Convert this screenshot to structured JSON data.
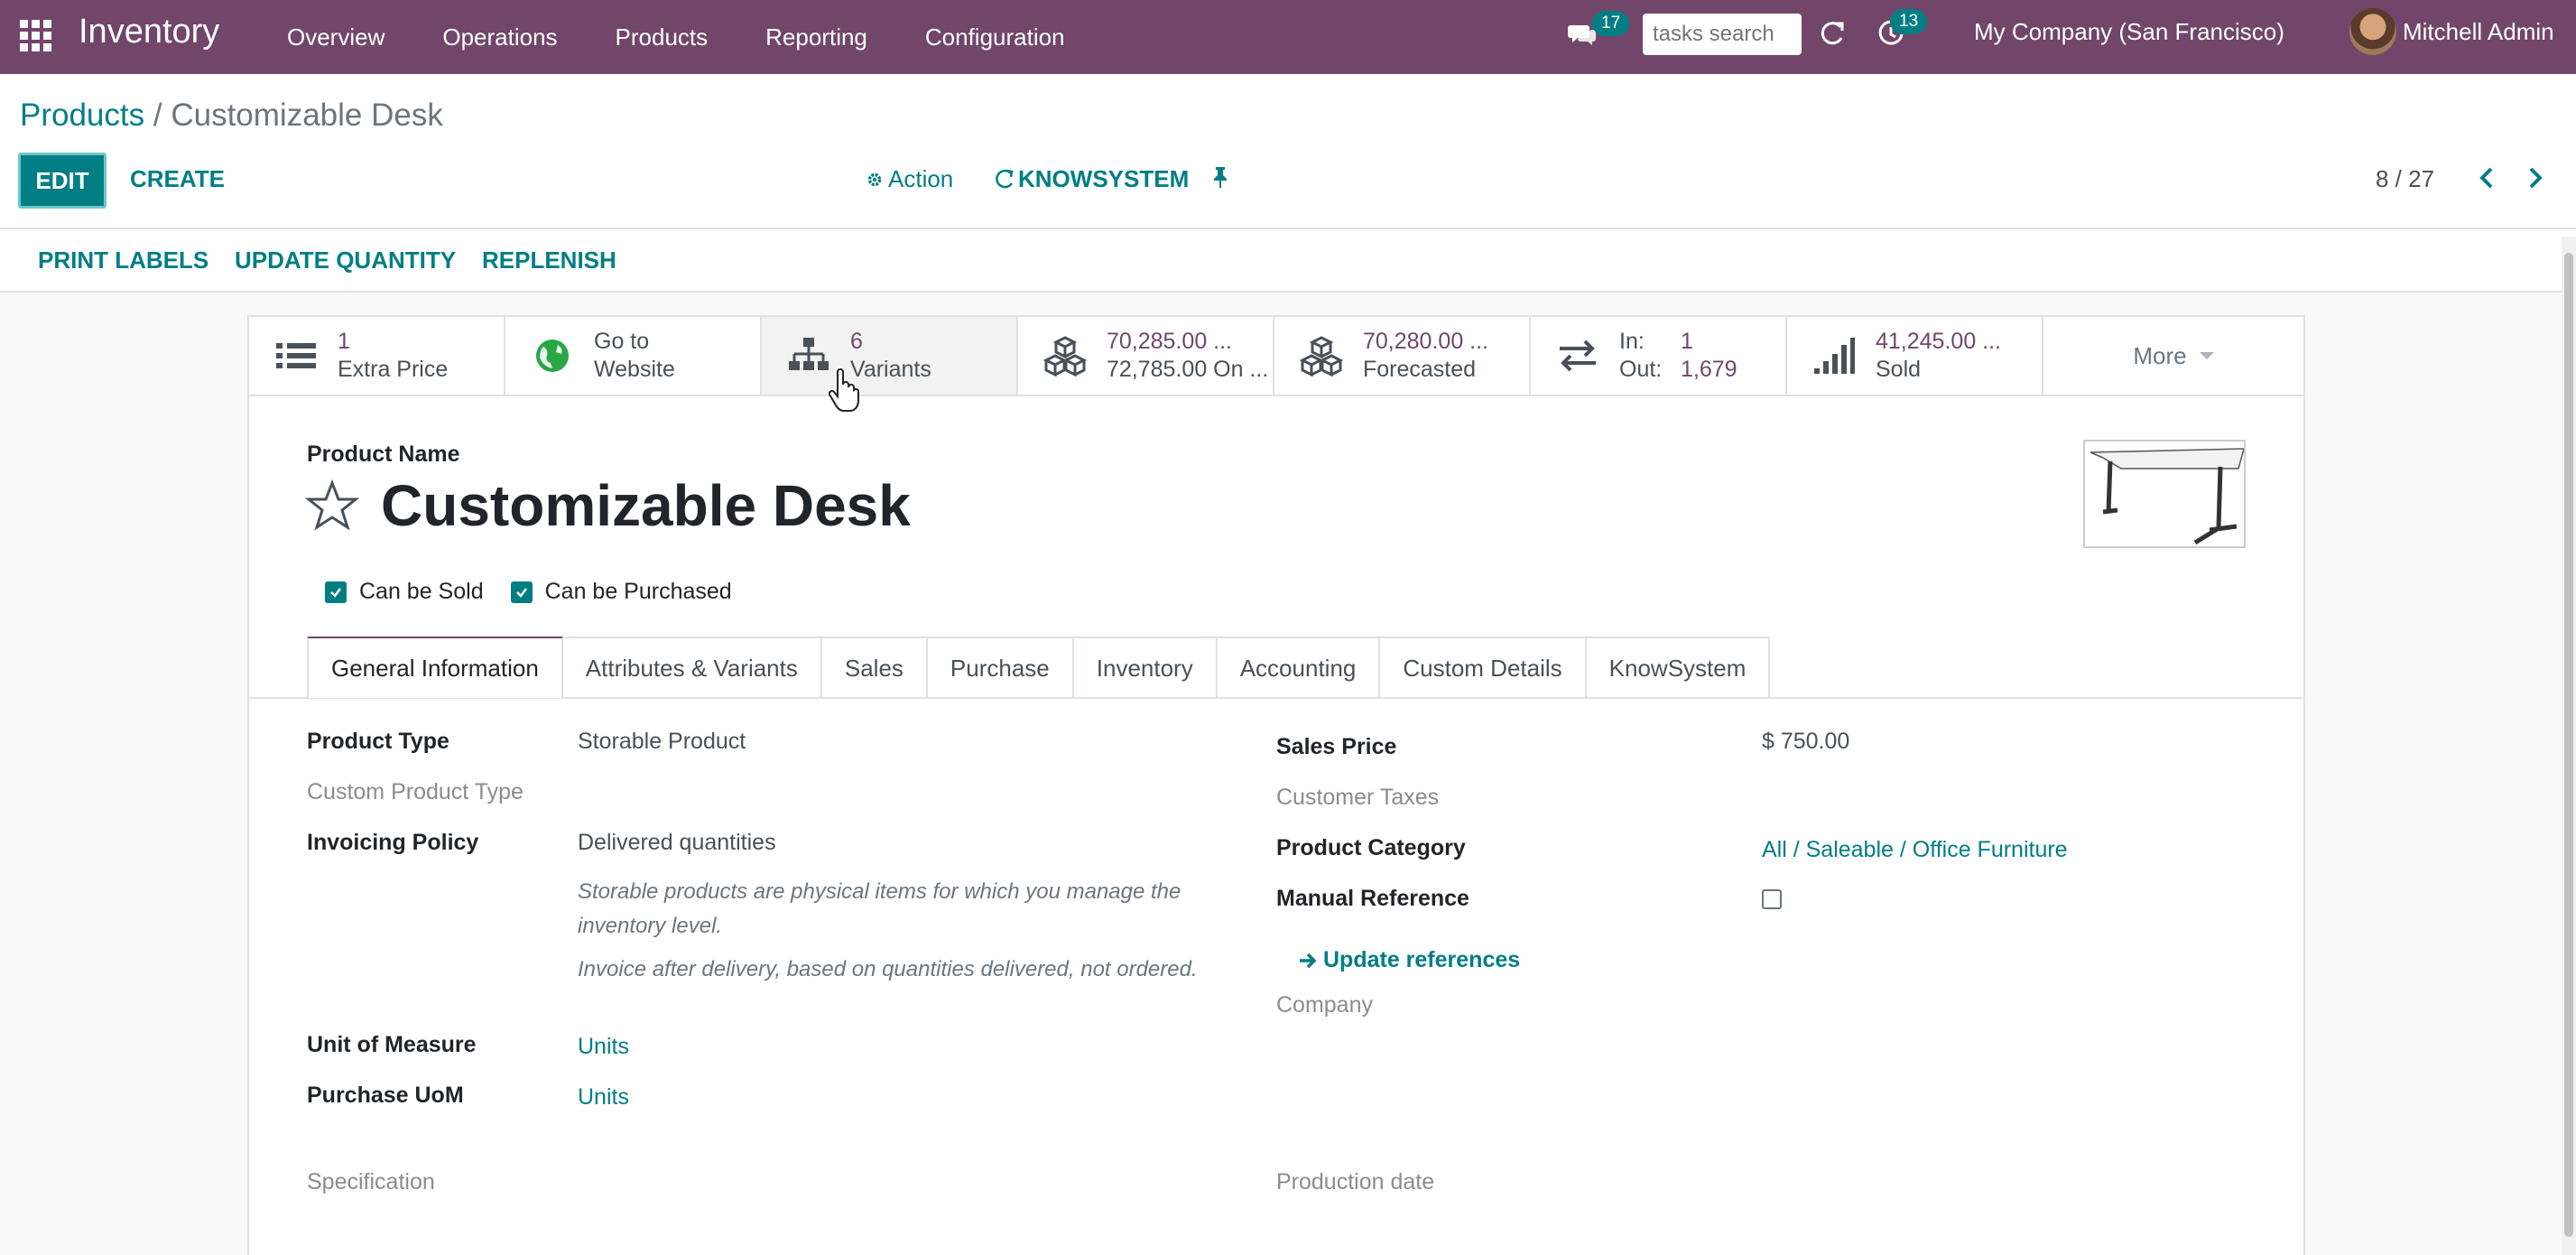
{
  "navbar": {
    "app_name": "Inventory",
    "menu": [
      "Overview",
      "Operations",
      "Products",
      "Reporting",
      "Configuration"
    ],
    "messages_count": "17",
    "search_placeholder": "tasks search",
    "activities_count": "13",
    "company": "My Company (San Francisco)",
    "user": "Mitchell Admin",
    "bg_color": "#71466a"
  },
  "breadcrumb": {
    "parent": "Products",
    "separator": "/",
    "current": "Customizable Desk"
  },
  "toolbar": {
    "edit": "EDIT",
    "create": "CREATE",
    "action": "Action",
    "knowsystem": "KNOWSYSTEM",
    "pager": "8 / 27"
  },
  "statusbar": {
    "buttons": [
      "PRINT LABELS",
      "UPDATE QUANTITY",
      "REPLENISH"
    ]
  },
  "smart_buttons": {
    "extra_price": {
      "value": "1",
      "label": "Extra Price",
      "icon": "list-icon"
    },
    "website": {
      "value": "Go to",
      "label": "Website",
      "icon": "globe-icon"
    },
    "variants": {
      "value": "6",
      "label": "Variants",
      "icon": "sitemap-icon"
    },
    "on_hand": {
      "value": "70,285.00 ...",
      "label": "72,785.00 On ...",
      "icon": "cubes-icon"
    },
    "forecasted": {
      "value": "70,280.00 ...",
      "label": "Forecasted",
      "icon": "cubes-icon"
    },
    "in_out": {
      "in_label": "In:",
      "in_value": "1",
      "out_label": "Out:",
      "out_value": "1,679",
      "icon": "exchange-icon"
    },
    "sold": {
      "value": "41,245.00 ...",
      "label": "Sold",
      "icon": "signal-icon"
    },
    "more": "More"
  },
  "product": {
    "name_label": "Product Name",
    "name": "Customizable Desk",
    "can_be_sold": "Can be Sold",
    "can_be_purchased": "Can be Purchased"
  },
  "tabs": [
    "General Information",
    "Attributes & Variants",
    "Sales",
    "Purchase",
    "Inventory",
    "Accounting",
    "Custom Details",
    "KnowSystem"
  ],
  "general": {
    "product_type_label": "Product Type",
    "product_type": "Storable Product",
    "custom_product_type_label": "Custom Product Type",
    "invoicing_policy_label": "Invoicing Policy",
    "invoicing_policy": "Delivered quantities",
    "help_storable": "Storable products are physical items for which you manage the inventory level.",
    "help_invoice": "Invoice after delivery, based on quantities delivered, not ordered.",
    "uom_label": "Unit of Measure",
    "uom": "Units",
    "purchase_uom_label": "Purchase UoM",
    "purchase_uom": "Units",
    "specification_label": "Specification",
    "sales_price_label": "Sales Price",
    "sales_price": "$ 750.00",
    "customer_taxes_label": "Customer Taxes",
    "product_category_label": "Product Category",
    "product_category": "All / Saleable / Office Furniture",
    "manual_reference_label": "Manual Reference",
    "update_references": "Update references",
    "company_label": "Company",
    "production_date_label": "Production date"
  }
}
